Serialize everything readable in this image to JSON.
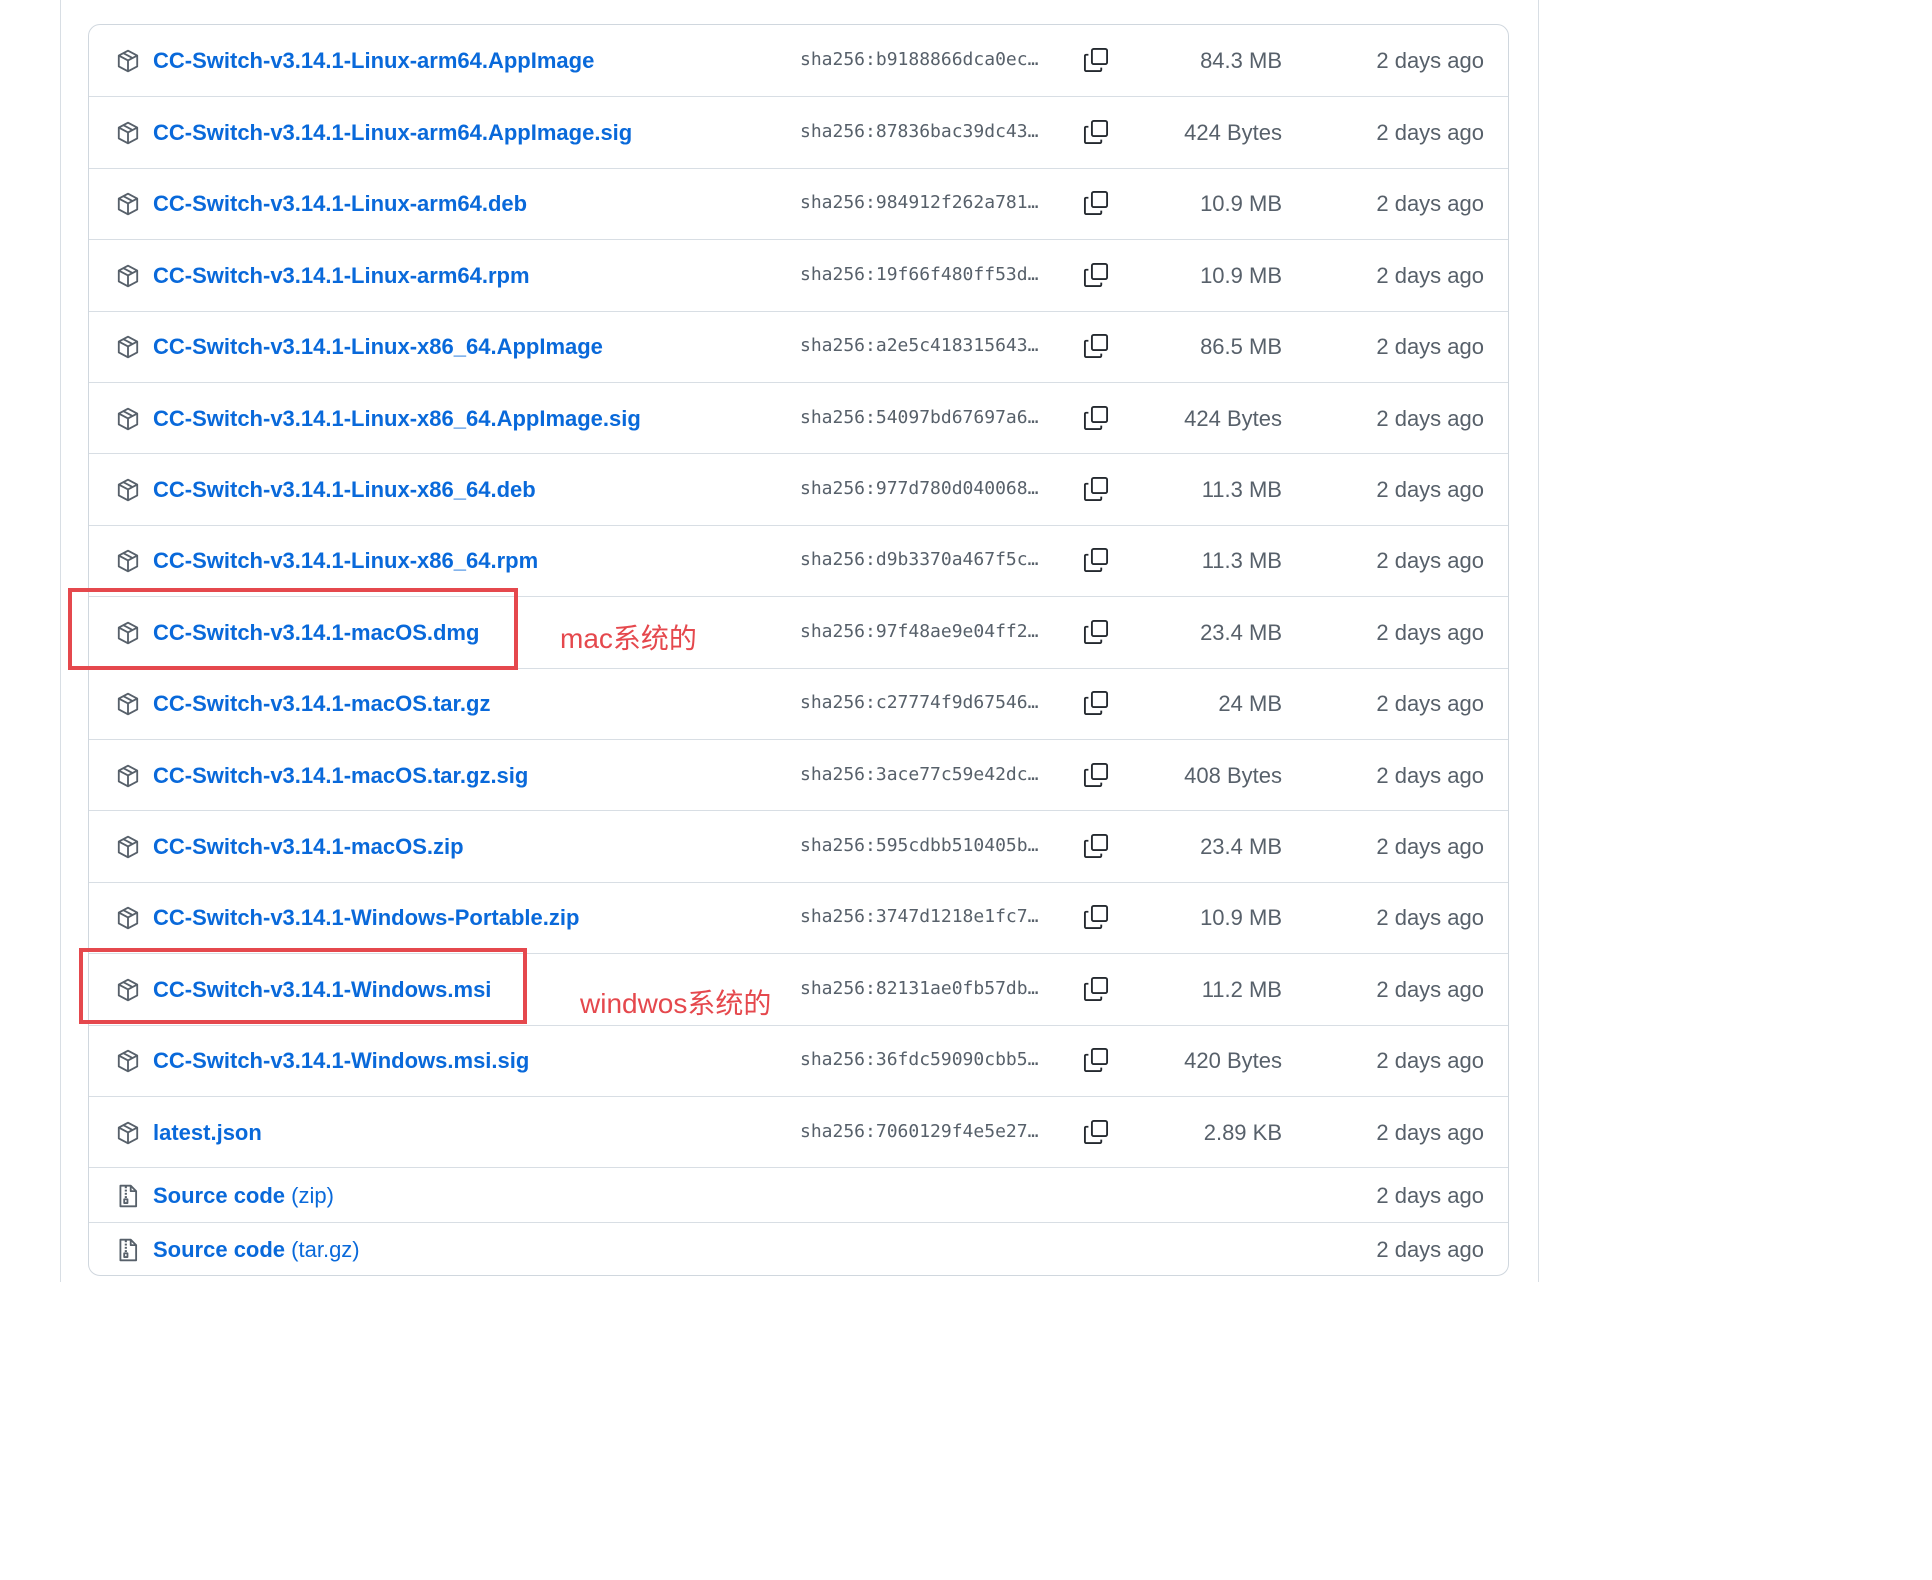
{
  "assets": [
    {
      "name": "CC-Switch-v3.14.1-Linux-arm64.AppImage",
      "hash": "sha256:b9188866dca0ec…",
      "size": "84.3 MB",
      "time": "2 days ago"
    },
    {
      "name": "CC-Switch-v3.14.1-Linux-arm64.AppImage.sig",
      "hash": "sha256:87836bac39dc43…",
      "size": "424 Bytes",
      "time": "2 days ago"
    },
    {
      "name": "CC-Switch-v3.14.1-Linux-arm64.deb",
      "hash": "sha256:984912f262a781…",
      "size": "10.9 MB",
      "time": "2 days ago"
    },
    {
      "name": "CC-Switch-v3.14.1-Linux-arm64.rpm",
      "hash": "sha256:19f66f480ff53d…",
      "size": "10.9 MB",
      "time": "2 days ago"
    },
    {
      "name": "CC-Switch-v3.14.1-Linux-x86_64.AppImage",
      "hash": "sha256:a2e5c418315643…",
      "size": "86.5 MB",
      "time": "2 days ago"
    },
    {
      "name": "CC-Switch-v3.14.1-Linux-x86_64.AppImage.sig",
      "hash": "sha256:54097bd67697a6…",
      "size": "424 Bytes",
      "time": "2 days ago"
    },
    {
      "name": "CC-Switch-v3.14.1-Linux-x86_64.deb",
      "hash": "sha256:977d780d040068…",
      "size": "11.3 MB",
      "time": "2 days ago"
    },
    {
      "name": "CC-Switch-v3.14.1-Linux-x86_64.rpm",
      "hash": "sha256:d9b3370a467f5c…",
      "size": "11.3 MB",
      "time": "2 days ago"
    },
    {
      "name": "CC-Switch-v3.14.1-macOS.dmg",
      "hash": "sha256:97f48ae9e04ff2…",
      "size": "23.4 MB",
      "time": "2 days ago"
    },
    {
      "name": "CC-Switch-v3.14.1-macOS.tar.gz",
      "hash": "sha256:c27774f9d67546…",
      "size": "24 MB",
      "time": "2 days ago"
    },
    {
      "name": "CC-Switch-v3.14.1-macOS.tar.gz.sig",
      "hash": "sha256:3ace77c59e42dc…",
      "size": "408 Bytes",
      "time": "2 days ago"
    },
    {
      "name": "CC-Switch-v3.14.1-macOS.zip",
      "hash": "sha256:595cdbb510405b…",
      "size": "23.4 MB",
      "time": "2 days ago"
    },
    {
      "name": "CC-Switch-v3.14.1-Windows-Portable.zip",
      "hash": "sha256:3747d1218e1fc7…",
      "size": "10.9 MB",
      "time": "2 days ago"
    },
    {
      "name": "CC-Switch-v3.14.1-Windows.msi",
      "hash": "sha256:82131ae0fb57db…",
      "size": "11.2 MB",
      "time": "2 days ago"
    },
    {
      "name": "CC-Switch-v3.14.1-Windows.msi.sig",
      "hash": "sha256:36fdc59090cbb5…",
      "size": "420 Bytes",
      "time": "2 days ago"
    },
    {
      "name": "latest.json",
      "hash": "sha256:7060129f4e5e27…",
      "size": "2.89 KB",
      "time": "2 days ago"
    }
  ],
  "source_code": [
    {
      "label": "Source code",
      "suffix": "(zip)",
      "time": "2 days ago"
    },
    {
      "label": "Source code",
      "suffix": "(tar.gz)",
      "time": "2 days ago"
    }
  ],
  "annotations": {
    "mac": "mac系统的",
    "windows": "windwos系统的"
  },
  "icons": {
    "asset": "package-icon",
    "source": "file-zip-icon",
    "copy": "copy-icon"
  },
  "colors": {
    "link": "#0969da",
    "muted": "#57606a",
    "border": "#d8dee4",
    "annotation": "#e5484d"
  }
}
